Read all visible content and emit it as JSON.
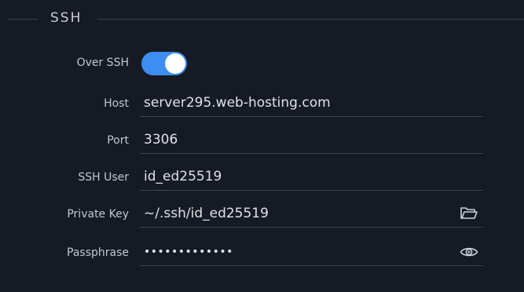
{
  "section": {
    "title": "SSH"
  },
  "over_ssh": {
    "label": "Over SSH",
    "enabled": true
  },
  "host": {
    "label": "Host",
    "value": "server295.web-hosting.com"
  },
  "port": {
    "label": "Port",
    "value": "3306"
  },
  "ssh_user": {
    "label": "SSH User",
    "value": "id_ed25519"
  },
  "private_key": {
    "label": "Private Key",
    "value": "~/.ssh/id_ed25519",
    "icon": "folder-open-icon"
  },
  "passphrase": {
    "label": "Passphrase",
    "masked_value": "•••••••••••••",
    "icon": "eye-icon"
  },
  "colors": {
    "background": "#161a24",
    "accent": "#3d8ef0",
    "divider": "#3d424d"
  }
}
